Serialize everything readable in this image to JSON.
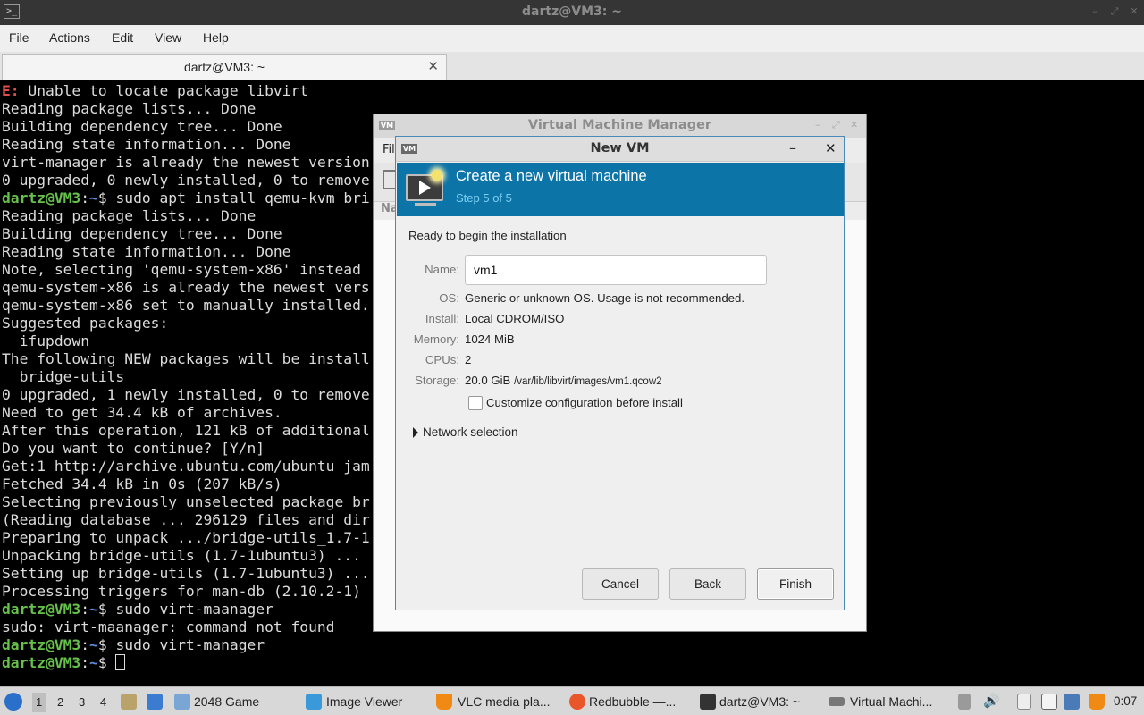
{
  "terminal": {
    "title": "dartz@VM3: ~",
    "app_icon": ">_",
    "menu": [
      "File",
      "Actions",
      "Edit",
      "View",
      "Help"
    ],
    "tab_label": "dartz@VM3: ~",
    "lines": [
      [
        {
          "t": "E:",
          "c": "err"
        },
        {
          "t": " Unable to locate package libvirt"
        }
      ],
      [
        {
          "t": "Reading package lists... Done"
        }
      ],
      [
        {
          "t": "Building dependency tree... Done"
        }
      ],
      [
        {
          "t": "Reading state information... Done"
        }
      ],
      [
        {
          "t": "virt-manager is already the newest version"
        }
      ],
      [
        {
          "t": "0 upgraded, 0 newly installed, 0 to remove"
        }
      ],
      [
        {
          "t": "dartz@VM3",
          "c": "usr"
        },
        {
          "t": ":"
        },
        {
          "t": "~",
          "c": "dir"
        },
        {
          "t": "$ sudo apt install qemu-kvm bri"
        }
      ],
      [
        {
          "t": "Reading package lists... Done"
        }
      ],
      [
        {
          "t": "Building dependency tree... Done"
        }
      ],
      [
        {
          "t": "Reading state information... Done"
        }
      ],
      [
        {
          "t": "Note, selecting 'qemu-system-x86' instead"
        }
      ],
      [
        {
          "t": "qemu-system-x86 is already the newest vers"
        }
      ],
      [
        {
          "t": "qemu-system-x86 set to manually installed."
        }
      ],
      [
        {
          "t": "Suggested packages:"
        }
      ],
      [
        {
          "t": "  ifupdown"
        }
      ],
      [
        {
          "t": "The following NEW packages will be install"
        }
      ],
      [
        {
          "t": "  bridge-utils"
        }
      ],
      [
        {
          "t": "0 upgraded, 1 newly installed, 0 to remove"
        }
      ],
      [
        {
          "t": "Need to get 34.4 kB of archives."
        }
      ],
      [
        {
          "t": "After this operation, 121 kB of additional"
        }
      ],
      [
        {
          "t": "Do you want to continue? [Y/n]"
        }
      ],
      [
        {
          "t": "Get:1 http://archive.ubuntu.com/ubuntu jam"
        }
      ],
      [
        {
          "t": "Fetched 34.4 kB in 0s (207 kB/s)"
        }
      ],
      [
        {
          "t": "Selecting previously unselected package br"
        }
      ],
      [
        {
          "t": "(Reading database ... 296129 files and dir"
        }
      ],
      [
        {
          "t": "Preparing to unpack .../bridge-utils_1.7-1"
        }
      ],
      [
        {
          "t": "Unpacking bridge-utils (1.7-1ubuntu3) ..."
        }
      ],
      [
        {
          "t": "Setting up bridge-utils (1.7-1ubuntu3) ..."
        }
      ],
      [
        {
          "t": "Processing triggers for man-db (2.10.2-1)"
        }
      ],
      [
        {
          "t": "dartz@VM3",
          "c": "usr"
        },
        {
          "t": ":"
        },
        {
          "t": "~",
          "c": "dir"
        },
        {
          "t": "$ sudo virt-maanager"
        }
      ],
      [
        {
          "t": "sudo: virt-maanager: command not found"
        }
      ],
      [
        {
          "t": "dartz@VM3",
          "c": "usr"
        },
        {
          "t": ":"
        },
        {
          "t": "~",
          "c": "dir"
        },
        {
          "t": "$ sudo virt-manager"
        }
      ],
      [
        {
          "t": "dartz@VM3",
          "c": "usr"
        },
        {
          "t": ":"
        },
        {
          "t": "~",
          "c": "dir"
        },
        {
          "t": "$ "
        },
        {
          "t": "",
          "c": "cursor"
        }
      ]
    ]
  },
  "vmm": {
    "title": "Virtual Machine Manager",
    "logo": "VM",
    "menu_peek": "Fil",
    "col_peek": "Na"
  },
  "newvm": {
    "title": "New VM",
    "logo": "VM",
    "header_title": "Create a new virtual machine",
    "header_step": "Step 5 of 5",
    "ready_text": "Ready to begin the installation",
    "fields": {
      "name_label": "Name:",
      "name_value": "vm1",
      "os_label": "OS:",
      "os_value": "Generic or unknown OS. Usage is not recommended.",
      "install_label": "Install:",
      "install_value": "Local CDROM/ISO",
      "memory_label": "Memory:",
      "memory_value": "1024 MiB",
      "cpus_label": "CPUs:",
      "cpus_value": "2",
      "storage_label": "Storage:",
      "storage_size": "20.0 GiB",
      "storage_path": "/var/lib/libvirt/images/vm1.qcow2"
    },
    "customize_label": "Customize configuration before install",
    "customize_checked": false,
    "network_label": "Network selection",
    "buttons": {
      "cancel": "Cancel",
      "back": "Back",
      "finish": "Finish"
    }
  },
  "taskbar": {
    "workspaces": [
      "1",
      "2",
      "3",
      "4"
    ],
    "active_workspace": "1",
    "tasks": [
      {
        "label": "2048 Game",
        "icon": "window-icon"
      },
      {
        "label": "Image Viewer",
        "icon": "image-viewer-icon"
      },
      {
        "label": "VLC media pla...",
        "icon": "vlc-cone-icon"
      },
      {
        "label": "Redbubble —...",
        "icon": "firefox-icon"
      },
      {
        "label": "dartz@VM3: ~",
        "icon": "terminal-icon"
      },
      {
        "label": "Virtual Machi...",
        "icon": "virt-manager-icon"
      }
    ],
    "clock": "0:07"
  }
}
